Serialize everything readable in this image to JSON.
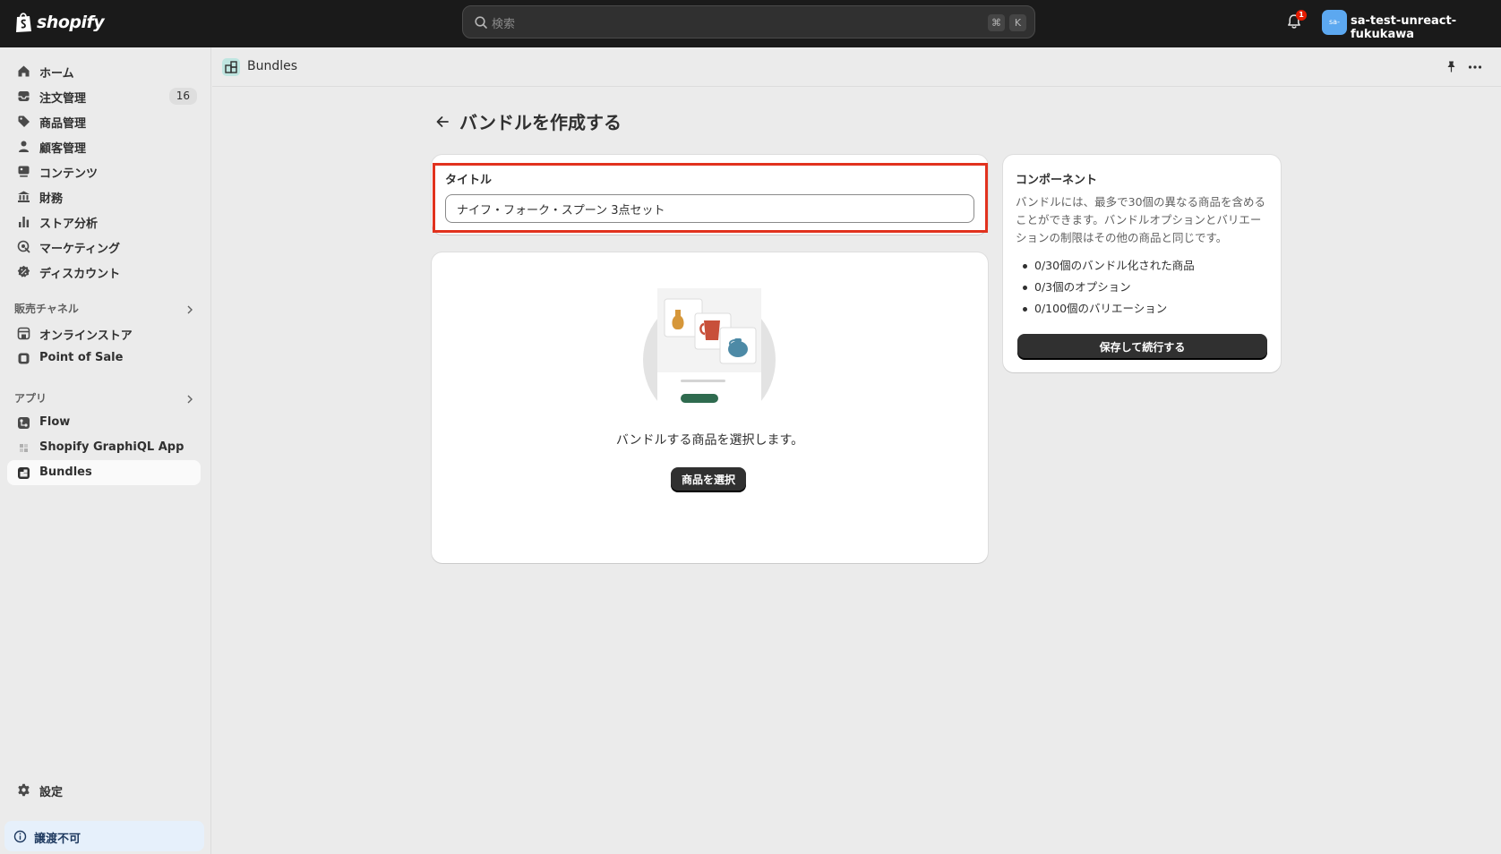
{
  "topbar": {
    "logo_text": "shopify",
    "search_placeholder": "検索",
    "shortcut_cmd": "⌘",
    "shortcut_key": "K",
    "notification_count": "1",
    "store_avatar": "sa-",
    "store_name": "sa-test-unreact-fukukawa"
  },
  "sidebar": {
    "items": [
      {
        "label": "ホーム",
        "icon": "home-icon"
      },
      {
        "label": "注文管理",
        "icon": "orders-icon",
        "count": "16"
      },
      {
        "label": "商品管理",
        "icon": "tag-icon"
      },
      {
        "label": "顧客管理",
        "icon": "person-icon"
      },
      {
        "label": "コンテンツ",
        "icon": "content-icon"
      },
      {
        "label": "財務",
        "icon": "bank-icon"
      },
      {
        "label": "ストア分析",
        "icon": "chart-icon"
      },
      {
        "label": "マーケティング",
        "icon": "target-icon"
      },
      {
        "label": "ディスカウント",
        "icon": "discount-icon"
      }
    ],
    "sales_channels": {
      "heading": "販売チャネル",
      "items": [
        {
          "label": "オンラインストア",
          "icon": "store-icon"
        },
        {
          "label": "Point of Sale",
          "icon": "pos-icon"
        }
      ]
    },
    "apps": {
      "heading": "アプリ",
      "items": [
        {
          "label": "Flow",
          "icon": "flow-icon"
        },
        {
          "label": "Shopify GraphiQL App",
          "icon": "graphiql-icon"
        },
        {
          "label": "Bundles",
          "icon": "bundles-icon",
          "active": true
        }
      ]
    },
    "settings_label": "設定",
    "notice_label": "譲渡不可"
  },
  "app_header": {
    "title": "Bundles"
  },
  "page": {
    "title": "バンドルを作成する",
    "title_field": {
      "label": "タイトル",
      "value": "ナイフ・フォーク・スプーン 3点セット"
    },
    "picker": {
      "text": "バンドルする商品を選択します。",
      "button": "商品を選択"
    },
    "components": {
      "title": "コンポーネント",
      "description": "バンドルには、最多で30個の異なる商品を含めることができます。バンドルオプションとバリエーションの制限はその他の商品と同じです。",
      "limits": [
        "0/30個のバンドル化された商品",
        "0/3個のオプション",
        "0/100個のバリエーション"
      ],
      "button": "保存して続行する"
    }
  },
  "colors": {
    "topbar_bg": "#1a1a1a",
    "page_bg": "#ebebeb",
    "primary_button": "#303030",
    "highlight_border": "#e1321e",
    "avatar": "#5ca8f0"
  }
}
